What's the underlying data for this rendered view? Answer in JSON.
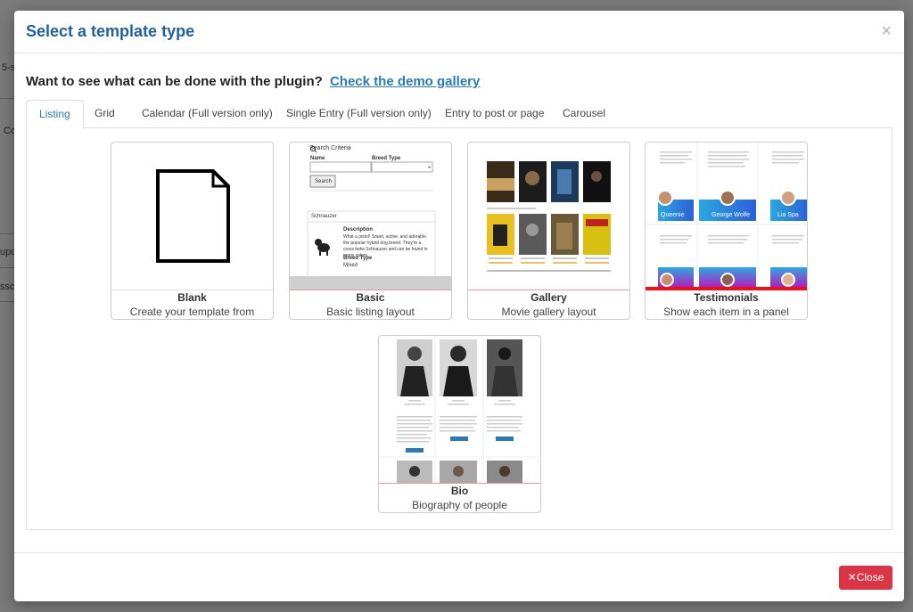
{
  "modal": {
    "title": "Select a template type",
    "close_glyph": "×",
    "intro_text": "Want to see what can be done with the plugin?",
    "intro_link": "Check the demo gallery"
  },
  "tabs": [
    {
      "label": "Listing",
      "active": true
    },
    {
      "label": "Grid",
      "active": false
    },
    {
      "label": "Calendar (Full version only)",
      "active": false
    },
    {
      "label": "Single Entry (Full version only)",
      "active": false
    },
    {
      "label": "Entry to post or page",
      "active": false
    },
    {
      "label": "Carousel",
      "active": false
    }
  ],
  "templates": [
    {
      "title": "Blank",
      "subtitle": "Create your template from scratch"
    },
    {
      "title": "Basic",
      "subtitle": "Basic listing layout"
    },
    {
      "title": "Gallery",
      "subtitle": "Movie gallery layout"
    },
    {
      "title": "Testimonials",
      "subtitle": "Show each item in a panel"
    },
    {
      "title": "Bio",
      "subtitle": "Biography of people"
    }
  ],
  "basic_preview": {
    "search_label": "Search Criteria",
    "name_label": "Name",
    "breed_label": "Breed Type",
    "search_button": "Search",
    "item_name": "Schnauzer",
    "desc_label": "Description",
    "desc_text": "What a pistol! Smart, active, and adorable, the popular hybrid dog breed. They're a cross betw Schnauzer and can be found in many colors.",
    "breed_type_label": "Breed Type",
    "breed_value": "Mixed"
  },
  "testimonials_preview": {
    "names": [
      "Queenie",
      "George Wolfe",
      "Lia Spa"
    ]
  },
  "footer": {
    "close_label": "Close",
    "close_glyph": "✕"
  },
  "background": {
    "fragments": [
      "5-s",
      "Co",
      "upd",
      "ssc"
    ]
  },
  "colors": {
    "title": "#1f5fa8",
    "link": "#2a7ab9",
    "danger": "#dc3545"
  }
}
